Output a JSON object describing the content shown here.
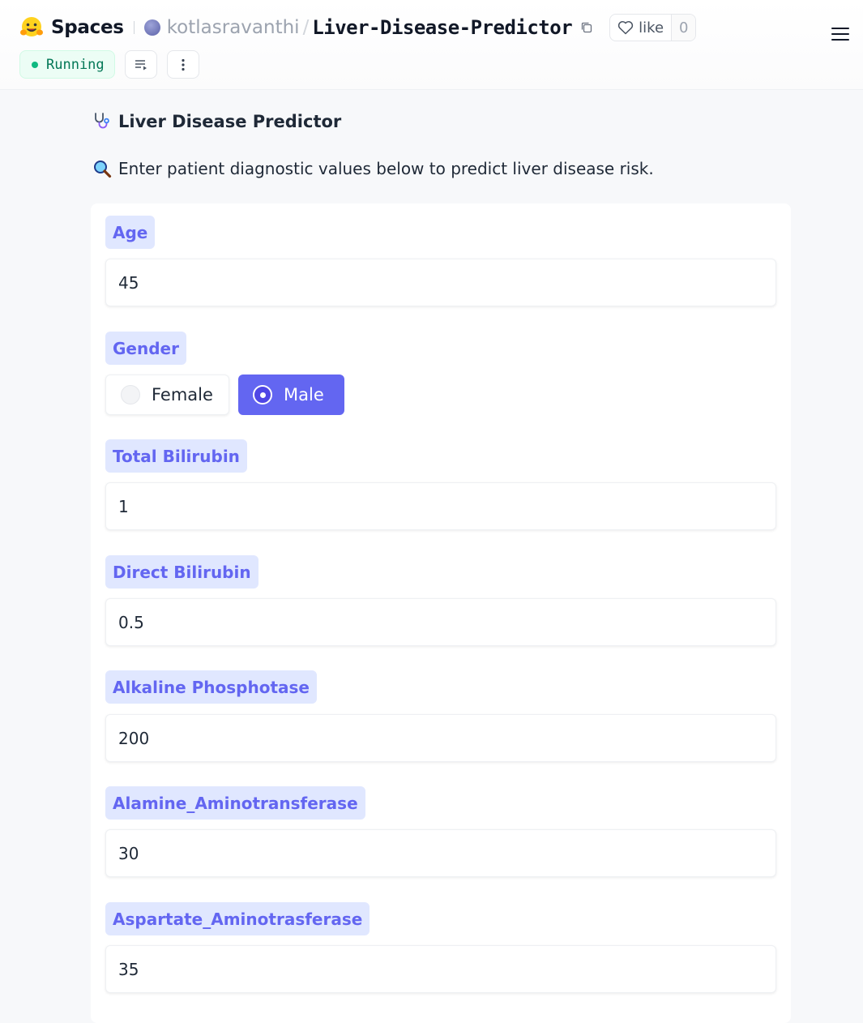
{
  "header": {
    "spaces_label": "Spaces",
    "owner": "kotlasravanthi",
    "separator": "/",
    "repo": "Liver-Disease-Predictor",
    "like_label": "like",
    "like_count": "0",
    "status": "Running"
  },
  "app": {
    "title": "Liver Disease Predictor",
    "description": "Enter patient diagnostic values below to predict liver disease risk."
  },
  "form": {
    "age": {
      "label": "Age",
      "value": "45"
    },
    "gender": {
      "label": "Gender",
      "options": [
        "Female",
        "Male"
      ],
      "selected": "Male"
    },
    "total_bilirubin": {
      "label": "Total Bilirubin",
      "value": "1"
    },
    "direct_bilirubin": {
      "label": "Direct Bilirubin",
      "value": "0.5"
    },
    "alkaline_phosphotase": {
      "label": "Alkaline Phosphotase",
      "value": "200"
    },
    "alamine_aminotransferase": {
      "label": "Alamine_Aminotransferase",
      "value": "30"
    },
    "aspartate_aminotrasferase": {
      "label": "Aspartate_Aminotrasferase",
      "value": "35"
    }
  },
  "colors": {
    "accent": "#6366f1",
    "label_bg": "#e0e7ff",
    "status_green": "#10b981"
  },
  "icons": {
    "logo": "hugging-face-logo",
    "copy": "copy-icon",
    "like": "heart-icon",
    "menu": "hamburger-menu-icon",
    "logs": "logs-icon",
    "more": "more-vertical-icon",
    "title": "stethoscope-icon",
    "description": "magnifying-glass-icon"
  }
}
